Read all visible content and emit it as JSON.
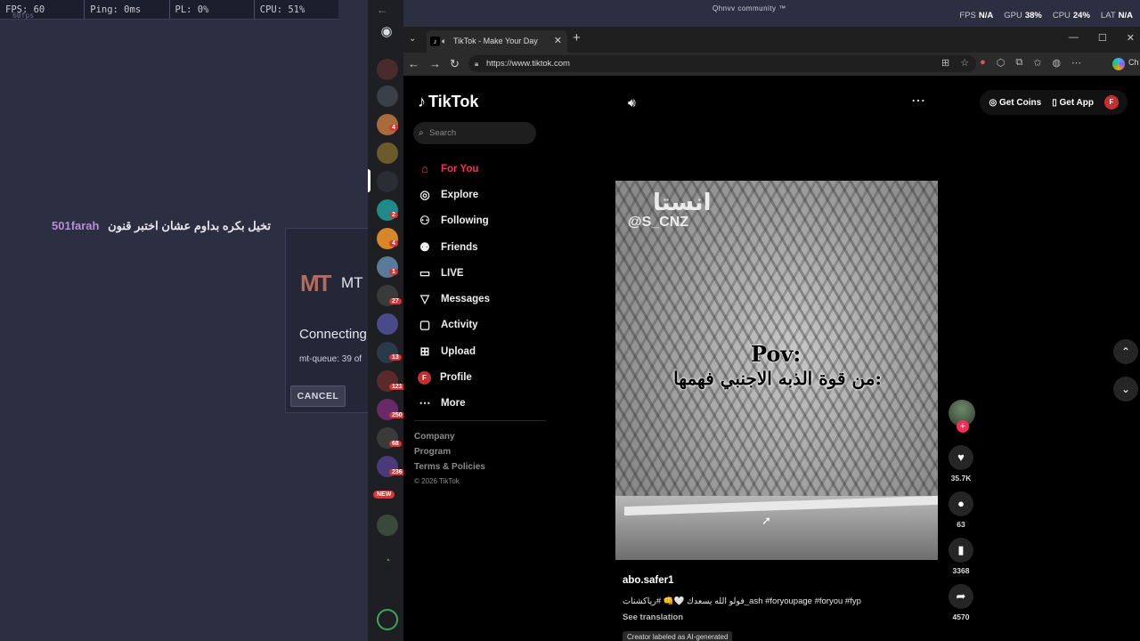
{
  "perf": {
    "fps": "FPS: 60",
    "ping": "Ping: 0ms",
    "pl": "PL: 0%",
    "cpu": "CPU: 51%",
    "sub": "60fps"
  },
  "chat": {
    "name": "501farah",
    "message": "تخيل بكره بداوم عشان اختبر قنون"
  },
  "mt_panel": {
    "logo": "MT",
    "logo_text": "MT",
    "status": "Connecting",
    "queue": "mt-queue: 39 of",
    "cancel": "CANCEL"
  },
  "discord": {
    "badges": [
      "4",
      "2",
      "4",
      "1",
      "27",
      "13",
      "121",
      "250",
      "68",
      "236",
      "NEW"
    ]
  },
  "hud": {
    "title": "Qhnvv community ™",
    "fps_label": "FPS",
    "fps_val": "N/A",
    "gpu_label": "GPU",
    "gpu_val": "38%",
    "cpu_label": "CPU",
    "cpu_val": "24%",
    "lat_label": "LAT",
    "lat_val": "N/A"
  },
  "browser": {
    "tab_title": "TikTok - Make Your Day",
    "url": "https://www.tiktok.com",
    "copilot_label": "Ch"
  },
  "tiktok": {
    "logo": "TikTok",
    "search_placeholder": "Search",
    "nav": [
      {
        "label": "For You",
        "icon": "home-icon",
        "active": true
      },
      {
        "label": "Explore",
        "icon": "compass-icon"
      },
      {
        "label": "Following",
        "icon": "following-icon"
      },
      {
        "label": "Friends",
        "icon": "friends-icon"
      },
      {
        "label": "LIVE",
        "icon": "live-icon"
      },
      {
        "label": "Messages",
        "icon": "messages-icon"
      },
      {
        "label": "Activity",
        "icon": "activity-icon"
      },
      {
        "label": "Upload",
        "icon": "upload-icon"
      },
      {
        "label": "Profile",
        "icon": "profile-avatar"
      },
      {
        "label": "More",
        "icon": "more-icon"
      }
    ],
    "footer": [
      "Company",
      "Program",
      "Terms & Policies"
    ],
    "copyright": "© 2026 TikTok",
    "get_coins": "Get Coins",
    "get_app": "Get App",
    "profile_initial": "F",
    "video": {
      "watermark_ar": "انستا",
      "watermark_handle": "@S_CNZ",
      "pov": "Pov:",
      "caption": "من قوة الذبه الاجنبي فهمها:",
      "author": "abo.safer1",
      "description": "فولو الله يسعدك 🤍👊 #رياكشنات_ash #foryoupage #foryou #fyp",
      "see_translation": "See translation",
      "ai_tag": "Creator labeled as AI-generated"
    },
    "actions": {
      "likes": "35.7K",
      "comments": "63",
      "saves": "3368",
      "shares": "4570"
    }
  },
  "colors": {
    "tiktok_accent": "#fe2c55",
    "chat_name": "#b98bd9",
    "mt_logo": "#b76a5c"
  }
}
